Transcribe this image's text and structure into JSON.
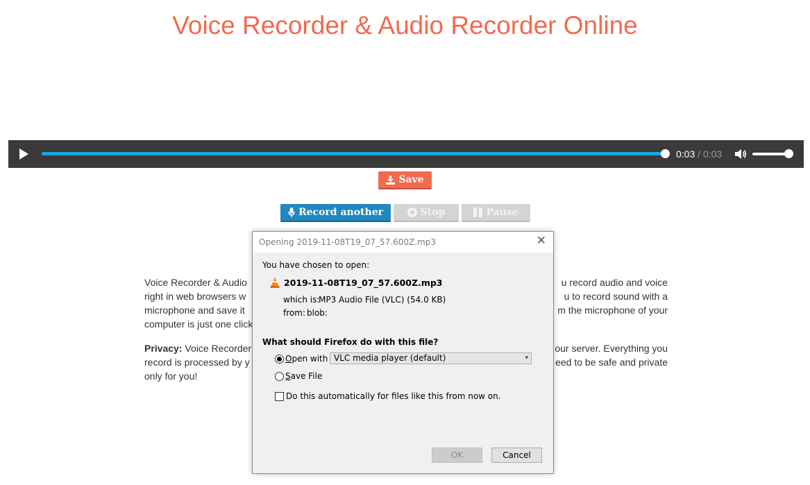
{
  "page": {
    "title": "Voice Recorder & Audio Recorder Online"
  },
  "player": {
    "current_time": "0:03",
    "separator": "/",
    "duration": "0:03",
    "progress": 1.0,
    "volume": 1.0,
    "accent_color": "#19a6e0"
  },
  "buttons": {
    "save_label": "Save",
    "record_another_label": "Record another",
    "stop_label": "Stop",
    "pause_label": "Pause"
  },
  "paragraphs": {
    "p1_left_lines": [
      "Voice Recorder & Audio",
      "right in web browsers w",
      "microphone and save it",
      "computer is just one click"
    ],
    "p1_right_lines": [
      "u record audio and voice",
      "u to record sound with a",
      "m the microphone of your",
      ""
    ],
    "p2_label": "Privacy:",
    "p2_left_lines": [
      " Voice Recorder",
      "record is processed by y",
      "only for you!"
    ],
    "p2_right_lines": [
      "our server. Everything you",
      "eed to be safe and private",
      ""
    ]
  },
  "dialog": {
    "title": "Opening 2019-11-08T19_07_57.600Z.mp3",
    "chosen_label": "You have chosen to open:",
    "filename": "2019-11-08T19_07_57.600Z.mp3",
    "which_is_label": "which is:",
    "which_is_value": "MP3 Audio File (VLC) (54.0 KB)",
    "from_label": "from:",
    "from_value": "blob:",
    "question": "What should Firefox do with this file?",
    "open_with_label": "Open with",
    "open_with_selected": "VLC media player (default)",
    "save_file_label": "Save File",
    "auto_label": "Do this automatically for files like this from now on.",
    "ok_label": "OK",
    "cancel_label": "Cancel",
    "open_with_checked": true,
    "save_file_checked": false,
    "auto_checked": false
  },
  "colors": {
    "title": "#f26a4f",
    "save_button": "#f26a4f",
    "record_button": "#1f88bd",
    "disabled_button": "#d4d4d4"
  }
}
